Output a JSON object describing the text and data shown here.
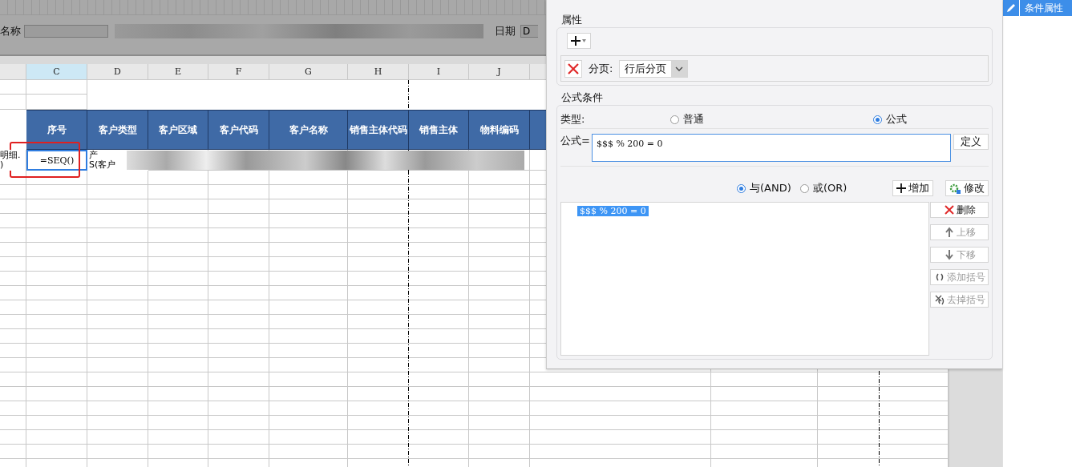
{
  "param_bar": {
    "name_label": "名称",
    "date_label": "日期",
    "date_value": "D"
  },
  "sheet": {
    "columns": [
      {
        "label": "C",
        "selected": true
      },
      {
        "label": "D",
        "selected": false
      },
      {
        "label": "E",
        "selected": false
      },
      {
        "label": "F",
        "selected": false
      },
      {
        "label": "G",
        "selected": false
      },
      {
        "label": "H",
        "selected": false
      },
      {
        "label": "I",
        "selected": false
      },
      {
        "label": "J",
        "selected": false
      }
    ],
    "headers": [
      "序号",
      "客户类型",
      "客户区域",
      "客户代码",
      "客户名称",
      "销售主体代码",
      "销售主体",
      "物料编码"
    ],
    "row_label_lines": [
      "明细.",
      ")"
    ],
    "active_cell": {
      "value": "=SEQ()",
      "annotated": true
    },
    "cell_d_lines": [
      "产",
      "S(客户"
    ]
  },
  "dialog": {
    "properties": {
      "title": "属性",
      "pagination_label": "分页:",
      "pagination_value": "行后分页"
    },
    "formula_condition": {
      "title": "公式条件",
      "type_label": "类型:",
      "types": [
        {
          "label": "普通",
          "selected": false
        },
        {
          "label": "公式",
          "selected": true
        }
      ],
      "formula_label": "公式=",
      "formula_value": "$$$ % 200 = 0",
      "define_button": "定义",
      "joins": [
        {
          "label": "与(AND)",
          "selected": true
        },
        {
          "label": "或(OR)",
          "selected": false
        }
      ],
      "add_button": "增加",
      "edit_button": "修改",
      "conditions": [
        {
          "text": "$$$ % 200 = 0",
          "selected": true
        }
      ],
      "side_buttons": [
        {
          "kind": "delete",
          "label": "删除",
          "disabled": false
        },
        {
          "kind": "up",
          "label": "上移",
          "disabled": true
        },
        {
          "kind": "down",
          "label": "下移",
          "disabled": true
        },
        {
          "kind": "add_bracket",
          "label": "添加括号",
          "disabled": true
        },
        {
          "kind": "remove_bracket",
          "label": "去掉括号",
          "disabled": true
        }
      ]
    }
  },
  "side_panel": {
    "tab": {
      "label": "条件属性",
      "selected": true
    }
  }
}
